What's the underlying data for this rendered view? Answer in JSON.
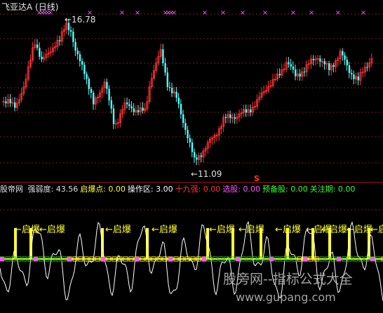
{
  "window": {
    "title": "飞亚达A (日线)"
  },
  "main_chart": {
    "high_label": "16.78",
    "low_label": "11.09",
    "s_marker": "S"
  },
  "indicator": {
    "name": "股帝网",
    "fields": [
      {
        "label": "强弱度:",
        "value": "43.56",
        "color": "#e0e0e0"
      },
      {
        "label": "启爆点:",
        "value": "0.00",
        "color": "#ffff33"
      },
      {
        "label": "操作区:",
        "value": "3.00",
        "color": "#ffffff"
      },
      {
        "label": "十九强:",
        "value": "0.00",
        "color": "#ff3333"
      },
      {
        "label": "选股:",
        "value": "0.00",
        "color": "#ff55ff"
      },
      {
        "label": "预备股:",
        "value": "0.00",
        "color": "#33ff33"
      },
      {
        "label": "关注期:",
        "value": "0.00",
        "color": "#33ff33"
      }
    ],
    "signal_label": "启爆"
  },
  "watermark": {
    "text": "股旁网--指标公式大全",
    "url": "www.gupang.com"
  },
  "colors": {
    "up_candle": "#ff3333",
    "down_candle": "#54ffff",
    "grid": "#7a1a1a",
    "separator": "#b01818",
    "marker": "#ff55ff",
    "line": "#ffffff",
    "signal": "#ffff33"
  }
}
